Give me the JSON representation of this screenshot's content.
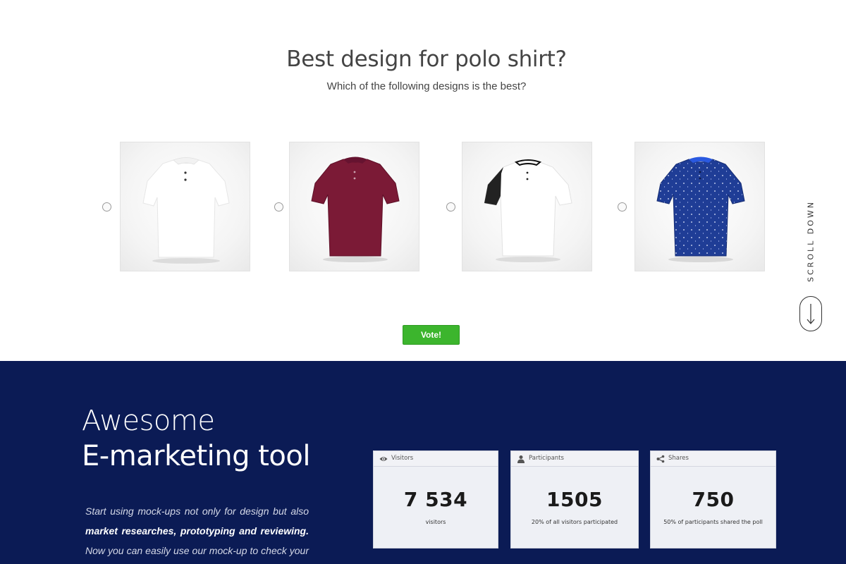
{
  "poll": {
    "title": "Best design for polo shirt?",
    "subtitle": "Which of the following designs is the best?",
    "options": [
      {
        "design": "white polo",
        "shirt_color": "#ffffff",
        "accent": "#e5e5e5"
      },
      {
        "design": "maroon polo",
        "shirt_color": "#7b1a36",
        "accent": "#5e1028"
      },
      {
        "design": "white polo with black sleeve",
        "shirt_color": "#ffffff",
        "accent": "#222222"
      },
      {
        "design": "navy dotted polo",
        "shirt_color": "#1f3d96",
        "accent": "#152c72"
      }
    ],
    "vote_label": "Vote!"
  },
  "scroll": {
    "label": "SCROLL DOWN"
  },
  "promo": {
    "line1": "Awesome",
    "line2": "E-marketing tool",
    "text_part1": "Start using mock-ups not only for design but also ",
    "text_bold": "market researches, prototyping and reviewing.",
    "text_part2": " Now you can easily use our mock-up to check your customers’"
  },
  "stats": [
    {
      "icon": "eye-icon",
      "label": "Visitors",
      "value": "7 534",
      "caption": "visitors"
    },
    {
      "icon": "user-icon",
      "label": "Participants",
      "value": "1505",
      "caption": "20% of all visitors participated"
    },
    {
      "icon": "share-icon",
      "label": "Shares",
      "value": "750",
      "caption": "50% of participants shared the poll"
    }
  ],
  "colors": {
    "accent_green": "#3cb52d",
    "navy": "#0b1b55"
  }
}
